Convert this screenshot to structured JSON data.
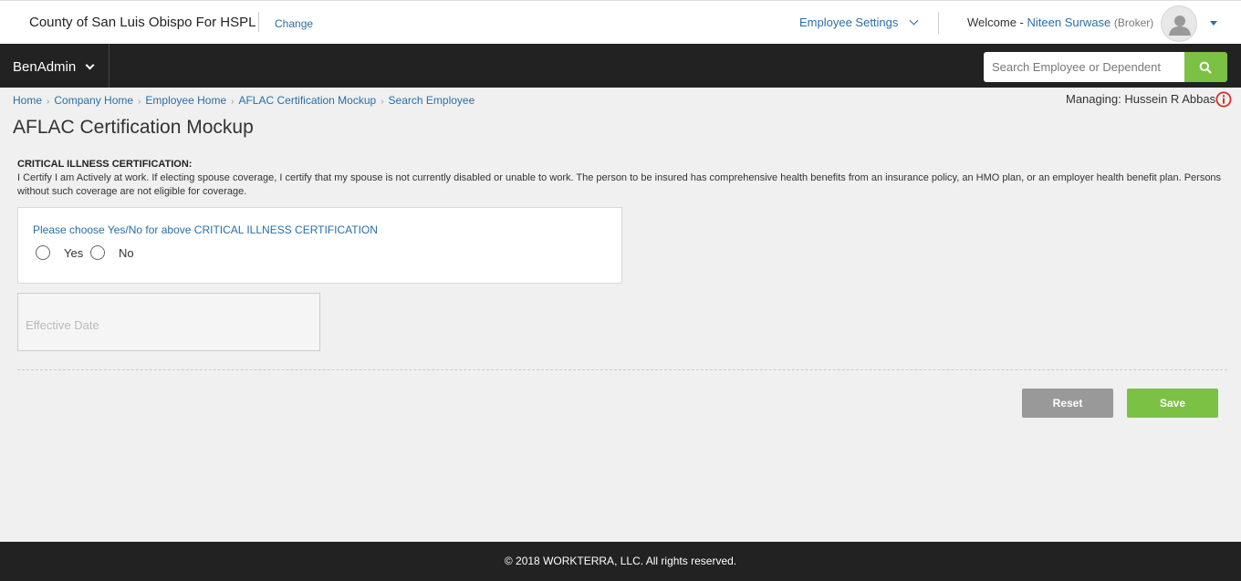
{
  "header": {
    "company_name": "County of San Luis Obispo For HSPL",
    "change_label": "Change",
    "employee_settings_label": "Employee Settings",
    "welcome_label": "Welcome -",
    "user_name": "Niteen Surwase",
    "user_role": "(Broker)"
  },
  "nav": {
    "app_menu_label": "BenAdmin",
    "search_placeholder": "Search Employee or Dependent"
  },
  "breadcrumb": [
    "Home",
    "Company Home",
    "Employee Home",
    "AFLAC Certification Mockup",
    "Search Employee"
  ],
  "managing": {
    "label": "Managing:",
    "name": "Hussein R Abbas"
  },
  "page": {
    "title": "AFLAC Certification Mockup",
    "cert_heading": "CRITICAL ILLNESS CERTIFICATION:",
    "cert_text": "I Certify I am Actively at work. If electing spouse coverage, I certify that my spouse is not currently disabled or unable to work. The person to be insured has comprehensive health benefits from an insurance policy, an HMO plan, or an employer health benefit plan. Persons without such coverage are not eligible for coverage.",
    "question": "Please choose Yes/No for above CRITICAL ILLNESS CERTIFICATION",
    "option_yes": "Yes",
    "option_no": "No",
    "effective_date_placeholder": "Effective Date"
  },
  "actions": {
    "reset_label": "Reset",
    "save_label": "Save"
  },
  "footer": {
    "copyright": "© 2018 WORKTERRA, LLC. All rights reserved."
  },
  "colors": {
    "accent_green": "#7bc143",
    "link_blue": "#2a6ea6",
    "nav_dark": "#222222",
    "info_red": "#d0302a"
  }
}
